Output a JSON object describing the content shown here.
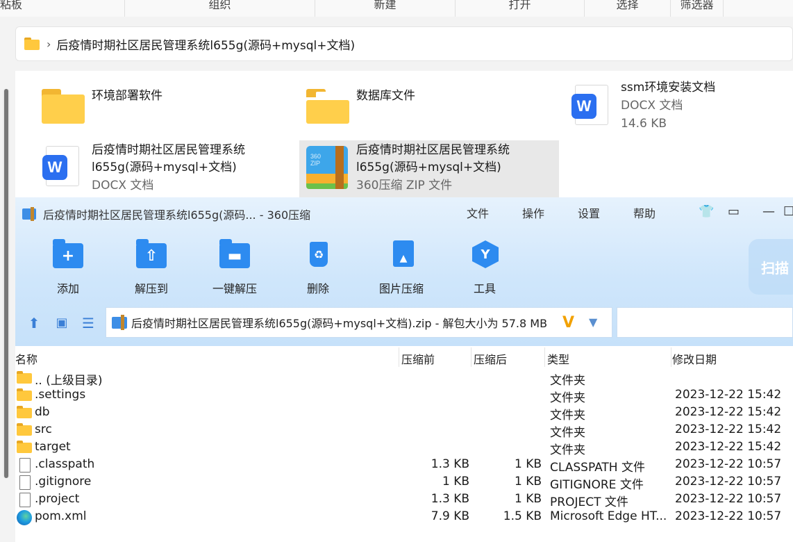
{
  "ribbon": {
    "groups": [
      "粘板",
      "组织",
      "新建",
      "打开",
      "选择",
      "筛选器"
    ]
  },
  "address": {
    "path": "后疫情时期社区居民管理系统l655g(源码+mysql+文档)"
  },
  "explorer": {
    "items": [
      {
        "name": "环境部署软件",
        "type": "",
        "size": ""
      },
      {
        "name": "数据库文件",
        "type": "",
        "size": ""
      },
      {
        "name": "ssm环境安装文档",
        "type": "DOCX 文档",
        "size": "14.6 KB"
      },
      {
        "name_line1": "后疫情时期社区居民管理系统",
        "name_line2": "l655g(源码+mysql+文档)",
        "type": "DOCX 文档"
      },
      {
        "name_line1": "后疫情时期社区居民管理系统",
        "name_line2": "l655g(源码+mysql+文档)",
        "type": "360压缩 ZIP 文件",
        "zip_label": "360\nZIP"
      }
    ]
  },
  "app": {
    "title": "后疫情时期社区居民管理系统l655g(源码... - 360压缩",
    "menu": [
      "文件",
      "操作",
      "设置",
      "帮助"
    ],
    "tools": [
      "添加",
      "解压到",
      "一键解压",
      "删除",
      "图片压缩",
      "工具"
    ],
    "scan_label": "扫描",
    "path": "后疫情时期社区居民管理系统l655g(源码+mysql+文档).zip - 解包大小为 57.8 MB"
  },
  "list": {
    "columns": [
      "名称",
      "压缩前",
      "压缩后",
      "类型",
      "修改日期"
    ],
    "rows": [
      {
        "name": ".. (上级目录)",
        "before": "",
        "after": "",
        "type": "文件夹",
        "date": "",
        "icon": "folder"
      },
      {
        "name": ".settings",
        "before": "",
        "after": "",
        "type": "文件夹",
        "date": "2023-12-22 15:42",
        "icon": "folder"
      },
      {
        "name": "db",
        "before": "",
        "after": "",
        "type": "文件夹",
        "date": "2023-12-22 15:42",
        "icon": "folder"
      },
      {
        "name": "src",
        "before": "",
        "after": "",
        "type": "文件夹",
        "date": "2023-12-22 15:42",
        "icon": "folder"
      },
      {
        "name": "target",
        "before": "",
        "after": "",
        "type": "文件夹",
        "date": "2023-12-22 15:42",
        "icon": "folder"
      },
      {
        "name": ".classpath",
        "before": "1.3 KB",
        "after": "1 KB",
        "type": "CLASSPATH 文件",
        "date": "2023-12-22 10:57",
        "icon": "file"
      },
      {
        "name": ".gitignore",
        "before": "1 KB",
        "after": "1 KB",
        "type": "GITIGNORE 文件",
        "date": "2023-12-22 10:57",
        "icon": "file"
      },
      {
        "name": ".project",
        "before": "1.3 KB",
        "after": "1 KB",
        "type": "PROJECT 文件",
        "date": "2023-12-22 10:57",
        "icon": "file"
      },
      {
        "name": "pom.xml",
        "before": "7.9 KB",
        "after": "1.5 KB",
        "type": "Microsoft Edge HT...",
        "date": "2023-12-22 10:57",
        "icon": "edge"
      }
    ]
  }
}
